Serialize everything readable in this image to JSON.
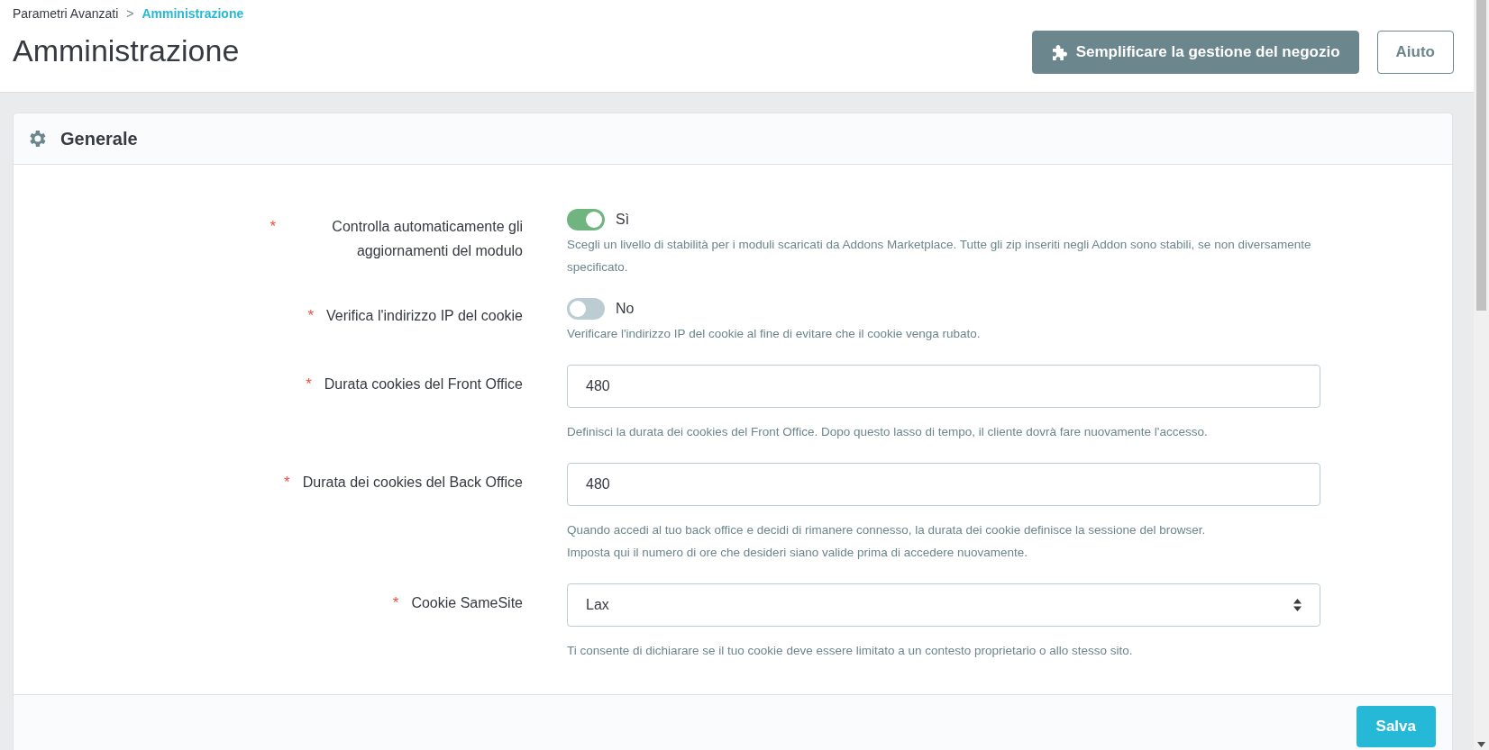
{
  "breadcrumb": [
    {
      "label": "Parametri Avanzati",
      "selected": false
    },
    {
      "label": "Amministrazione",
      "selected": true
    }
  ],
  "breadcrumb_separator": ">",
  "page_title": "Amministrazione",
  "header_buttons": [
    {
      "kind": "primary",
      "label": "Semplificare la gestione del negozio"
    },
    {
      "kind": "outline",
      "label": "Aiuto"
    }
  ],
  "panel": {
    "title": "Generale",
    "fields": [
      {
        "kind": "toggle",
        "required_mark": "*",
        "label": "Controlla automaticamente gli aggiornamenti del modulo",
        "on": true,
        "value": "Sì",
        "help": [
          "Scegli un livello di stabilità per i moduli scaricati da Addons Marketplace. Tutte gli zip inseriti negli Addon sono stabili, se non diversamente specificato."
        ]
      },
      {
        "kind": "toggle",
        "required_mark": "*",
        "label": "Verifica l'indirizzo IP del cookie",
        "on": false,
        "value": "No",
        "help": [
          "Verificare l'indirizzo IP del cookie al fine di evitare che il cookie venga rubato."
        ]
      },
      {
        "kind": "text",
        "required_mark": "*",
        "label": "Durata cookies del Front Office",
        "value": "480",
        "help": [
          "Definisci la durata dei cookies del Front Office. Dopo questo lasso di tempo, il cliente dovrà fare nuovamente l'accesso."
        ]
      },
      {
        "kind": "text",
        "required_mark": "*",
        "label": "Durata dei cookies del Back Office",
        "value": "480",
        "help": [
          "Quando accedi al tuo back office e decidi di rimanere connesso, la durata dei cookie definisce la sessione del browser.",
          "Imposta qui il numero di ore che desideri siano valide prima di accedere nuovamente."
        ]
      },
      {
        "kind": "select",
        "required_mark": "*",
        "label": "Cookie SameSite",
        "value": "Lax",
        "help": [
          "Ti consente di dichiarare se il tuo cookie deve essere limitato a un contesto proprietario o allo stesso sito."
        ]
      }
    ],
    "save_button": "Salva"
  }
}
